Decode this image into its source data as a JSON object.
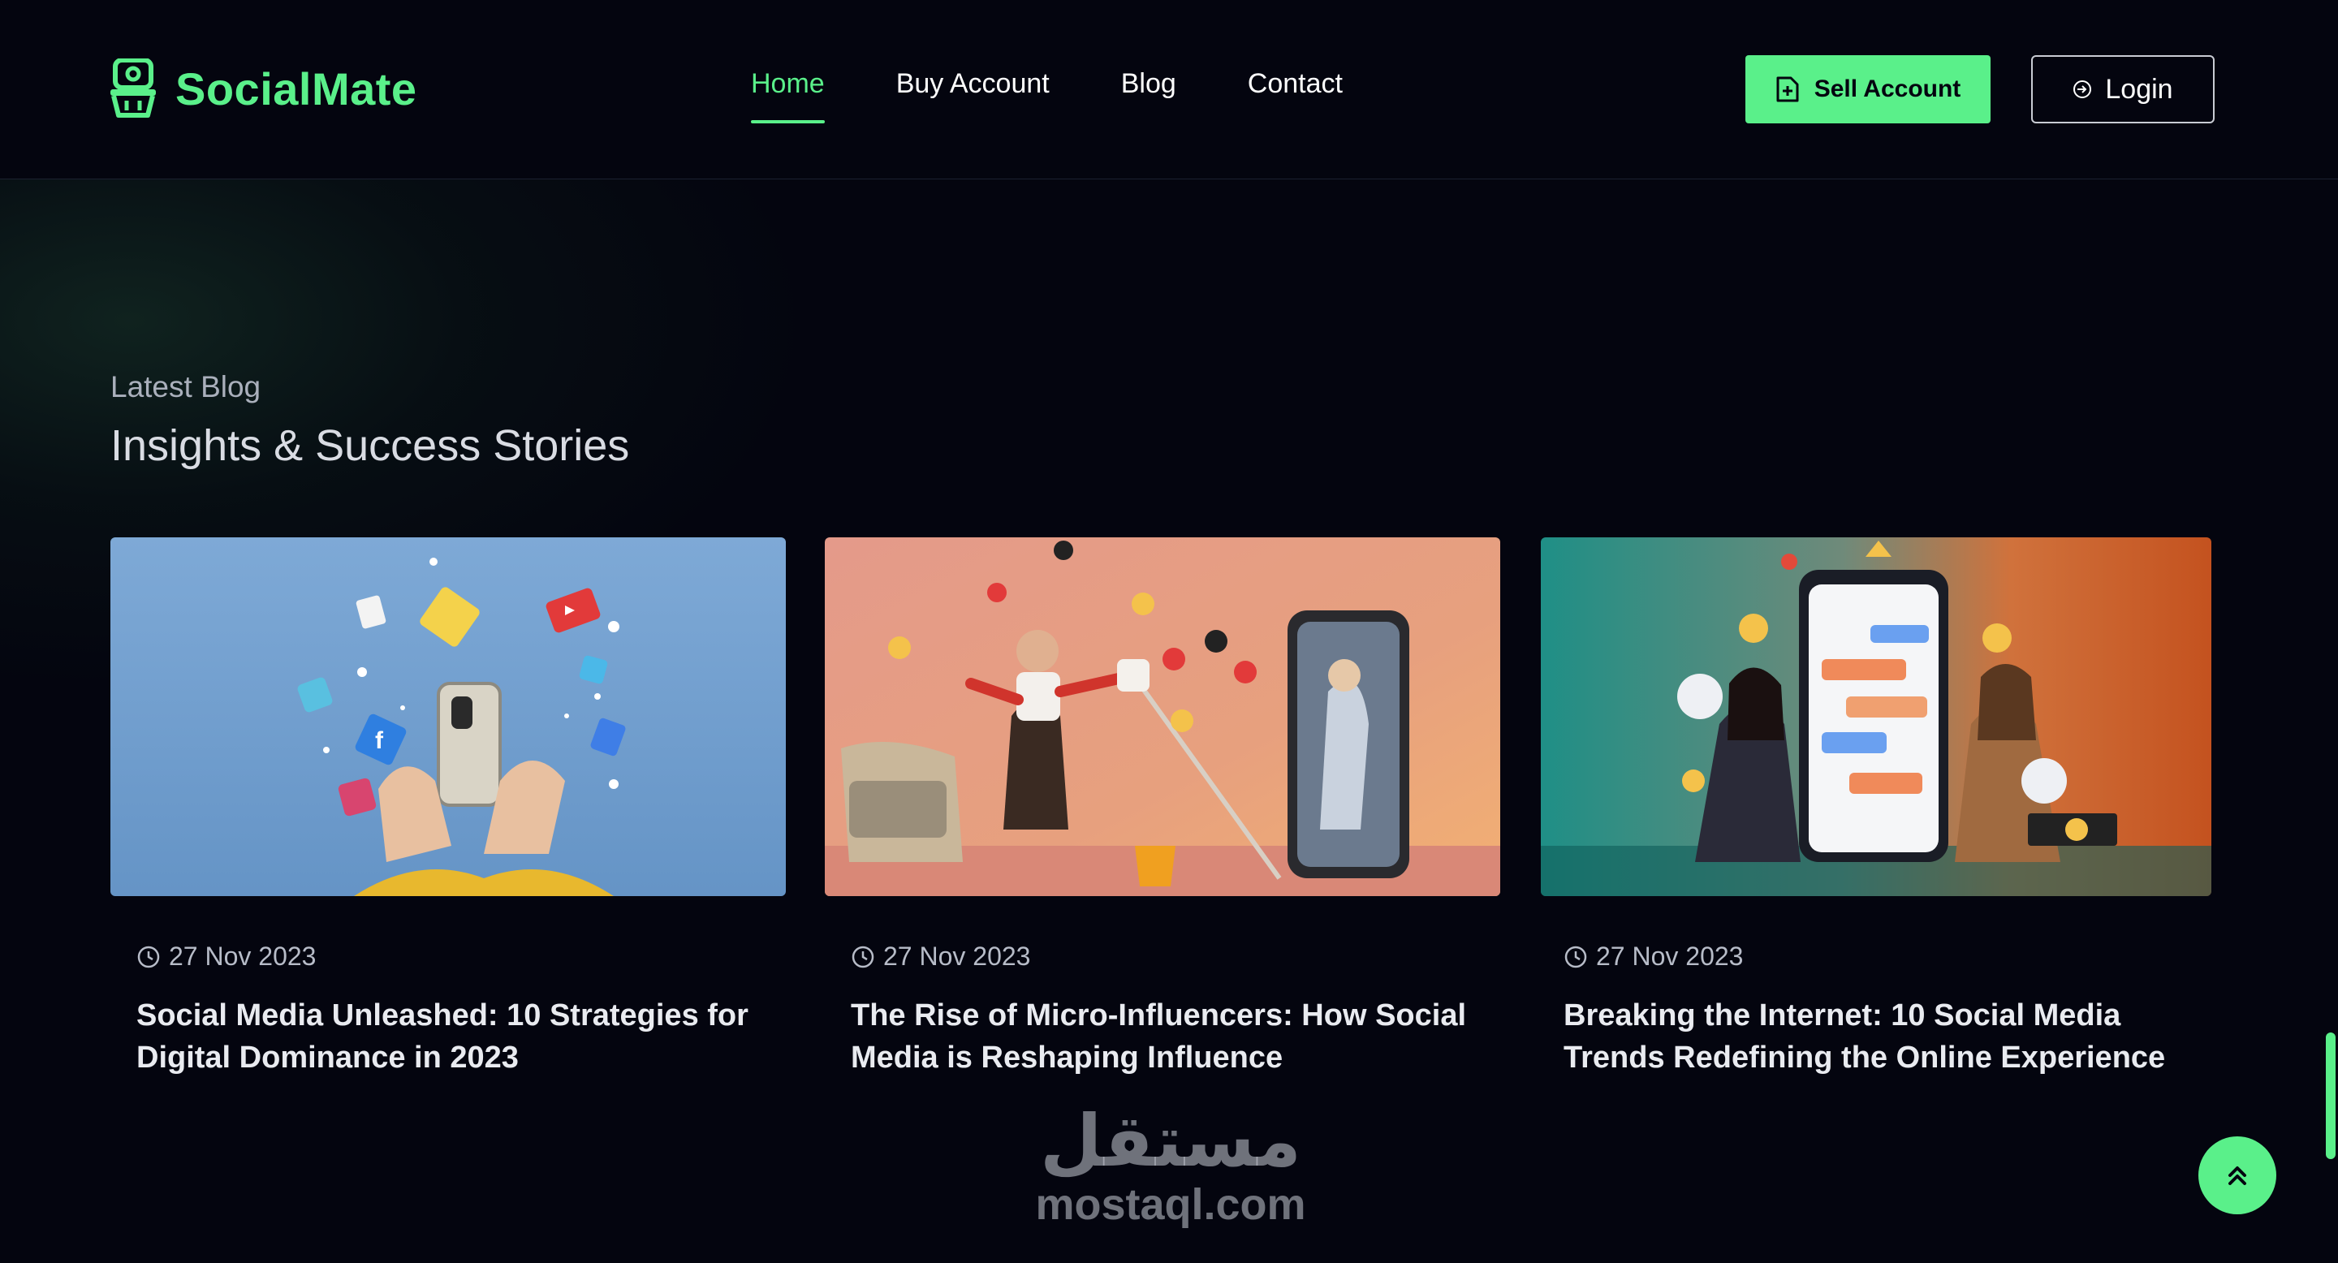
{
  "header": {
    "brand": "SocialMate",
    "nav": [
      {
        "label": "Home",
        "active": true
      },
      {
        "label": "Buy Account",
        "active": false
      },
      {
        "label": "Blog",
        "active": false
      },
      {
        "label": "Contact",
        "active": false
      }
    ],
    "sell_label": "Sell Account",
    "login_label": "Login"
  },
  "section": {
    "kicker": "Latest Blog",
    "title": "Insights & Success Stories"
  },
  "posts": [
    {
      "date": "27 Nov 2023",
      "title": "Social Media Unleashed: 10 Strategies for Digital Dominance in 2023"
    },
    {
      "date": "27 Nov 2023",
      "title": "The Rise of Micro-Influencers: How Social Media is Reshaping Influence"
    },
    {
      "date": "27 Nov 2023",
      "title": "Breaking the Internet: 10 Social Media Trends Redefining the Online Experience"
    }
  ],
  "watermark": {
    "arabic": "مستقل",
    "latin": "mostaql.com"
  },
  "icons": {
    "logo": "basket-logo-icon",
    "sell": "document-plus-icon",
    "login": "login-arrow-icon",
    "date": "clock-icon",
    "scroll_top": "double-chevron-up-icon"
  },
  "colors": {
    "accent": "#5af08a",
    "background": "#04050f",
    "text": "#e9ebf0",
    "muted": "#aab0bc"
  }
}
